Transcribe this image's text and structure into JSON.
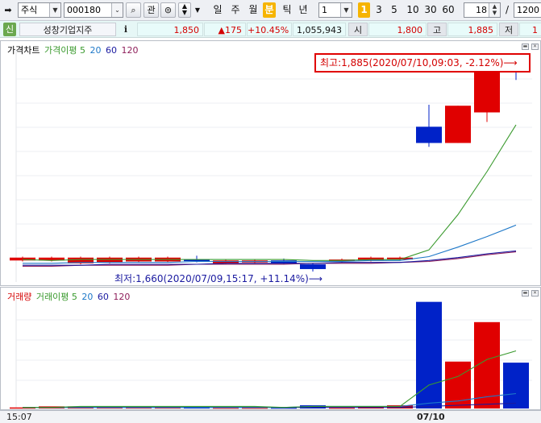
{
  "toolbar": {
    "market_select": "주식",
    "stock_code": "000180",
    "btn_interest": "관",
    "period_tabs": [
      {
        "label": "일",
        "active": false
      },
      {
        "label": "주",
        "active": false
      },
      {
        "label": "월",
        "active": false
      },
      {
        "label": "분",
        "active": true
      },
      {
        "label": "틱",
        "active": false
      },
      {
        "label": "년",
        "active": false
      }
    ],
    "interval_value": "1",
    "interval_buttons": [
      {
        "label": "1",
        "active": true
      },
      {
        "label": "3",
        "active": false
      },
      {
        "label": "5",
        "active": false
      },
      {
        "label": "10",
        "active": false
      },
      {
        "label": "30",
        "active": false
      },
      {
        "label": "60",
        "active": false
      }
    ],
    "display_count": "18",
    "slash": "/",
    "total_count": "1200"
  },
  "info": {
    "badge": "신",
    "stock_name": "성창기업지주",
    "info_icon": "i",
    "price": "1,850",
    "change": "▲175",
    "change_rate": "+10.45%",
    "volume": "1,055,943",
    "open_label": "시",
    "open_value": "1,800",
    "high_label": "고",
    "high_value": "1,885",
    "low_label": "저",
    "low_value": "1"
  },
  "price_pane": {
    "legend": [
      {
        "text": "가격차트",
        "color": "#000000"
      },
      {
        "text": "가격이평 5",
        "color": "#3a9a2e"
      },
      {
        "text": "20",
        "color": "#1e78c8"
      },
      {
        "text": "60",
        "color": "#1a1aa0"
      },
      {
        "text": "120",
        "color": "#8e1e5a"
      }
    ],
    "high_callout": "최고:1,885(2020/07/10,09:03, -2.12%)⟶",
    "low_callout": "최저:1,660(2020/07/09,15:17, +11.14%)⟶"
  },
  "volume_pane": {
    "legend": [
      {
        "text": "거래량",
        "color": "#d40000"
      },
      {
        "text": "거래이평 5",
        "color": "#3a9a2e"
      },
      {
        "text": "20",
        "color": "#1e78c8"
      },
      {
        "text": "60",
        "color": "#1a1aa0"
      },
      {
        "text": "120",
        "color": "#8e1e5a"
      }
    ]
  },
  "time_axis": {
    "start_label": "15:07",
    "date_label": "07/10"
  },
  "colors": {
    "up": "#e00000",
    "down": "#0022c8",
    "ma5": "#3a9a2e",
    "ma20": "#1e78c8",
    "ma60": "#1a1aa0",
    "ma120": "#8e1e5a"
  },
  "chart_data": {
    "type": "candlestick",
    "y_range": [
      1655,
      1892
    ],
    "candles": [
      {
        "dir": "up",
        "open": 1675,
        "close": 1678,
        "high": 1679,
        "low": 1674
      },
      {
        "dir": "up",
        "open": 1675,
        "close": 1678,
        "high": 1679,
        "low": 1674
      },
      {
        "dir": "up",
        "open": 1672,
        "close": 1678,
        "high": 1679,
        "low": 1671
      },
      {
        "dir": "up",
        "open": 1673,
        "close": 1678,
        "high": 1679,
        "low": 1672
      },
      {
        "dir": "up",
        "open": 1674,
        "close": 1678,
        "high": 1679,
        "low": 1673
      },
      {
        "dir": "up",
        "open": 1674,
        "close": 1678,
        "high": 1679,
        "low": 1673
      },
      {
        "dir": "down",
        "open": 1676,
        "close": 1675,
        "high": 1680,
        "low": 1673
      },
      {
        "dir": "up",
        "open": 1672,
        "close": 1675,
        "high": 1676,
        "low": 1671
      },
      {
        "dir": "up",
        "open": 1673,
        "close": 1675,
        "high": 1676,
        "low": 1672
      },
      {
        "dir": "down",
        "open": 1675,
        "close": 1672,
        "high": 1677,
        "low": 1671
      },
      {
        "dir": "down",
        "open": 1671,
        "close": 1666,
        "high": 1672,
        "low": 1660
      },
      {
        "dir": "up",
        "open": 1674,
        "close": 1676,
        "high": 1677,
        "low": 1673
      },
      {
        "dir": "up",
        "open": 1675,
        "close": 1678,
        "high": 1679,
        "low": 1674
      },
      {
        "dir": "up",
        "open": 1676,
        "close": 1678,
        "high": 1679,
        "low": 1675
      },
      {
        "dir": "down",
        "open": 1815,
        "close": 1798,
        "high": 1838,
        "low": 1794
      },
      {
        "dir": "up",
        "open": 1798,
        "close": 1837,
        "high": 1837,
        "low": 1798
      },
      {
        "dir": "up",
        "open": 1830,
        "close": 1872,
        "high": 1872,
        "low": 1820
      },
      {
        "dir": "down",
        "open": 1878,
        "close": 1875,
        "high": 1885,
        "low": 1864
      }
    ],
    "ma5": [
      1676,
      1675,
      1676,
      1676,
      1676,
      1676,
      1676,
      1676,
      1676,
      1676,
      1675,
      1675,
      1676,
      1676,
      1686,
      1723,
      1768,
      1817
    ],
    "ma20": [
      1672,
      1672,
      1673,
      1673,
      1673,
      1673,
      1674,
      1674,
      1674,
      1674,
      1674,
      1674,
      1675,
      1675,
      1679,
      1689,
      1700,
      1712
    ],
    "ma60": [
      1670,
      1670,
      1670,
      1671,
      1671,
      1671,
      1671,
      1672,
      1672,
      1672,
      1672,
      1673,
      1673,
      1673,
      1675,
      1678,
      1682,
      1685
    ],
    "ma120": [
      1669,
      1669,
      1670,
      1670,
      1670,
      1670,
      1671,
      1671,
      1671,
      1671,
      1672,
      1672,
      1672,
      1673,
      1674,
      1677,
      1681,
      1684
    ],
    "volume": {
      "values": [
        1,
        2,
        2,
        2,
        2,
        2,
        2,
        1,
        1,
        1,
        3,
        1,
        2,
        3,
        100,
        44,
        81,
        43
      ],
      "ma5": [
        1,
        1,
        2,
        2,
        2,
        2,
        2,
        2,
        2,
        1,
        2,
        2,
        2,
        2,
        22,
        30,
        46,
        54
      ],
      "ma20": [
        1,
        1,
        1,
        1,
        1,
        1,
        1,
        1,
        1,
        1,
        2,
        2,
        2,
        2,
        5,
        7,
        11,
        14
      ],
      "ma60": [
        1,
        1,
        1,
        1,
        1,
        1,
        1,
        1,
        1,
        1,
        1,
        1,
        1,
        1,
        2,
        3,
        4,
        5
      ]
    },
    "x_labels": [
      "15:07",
      "07/10"
    ]
  }
}
